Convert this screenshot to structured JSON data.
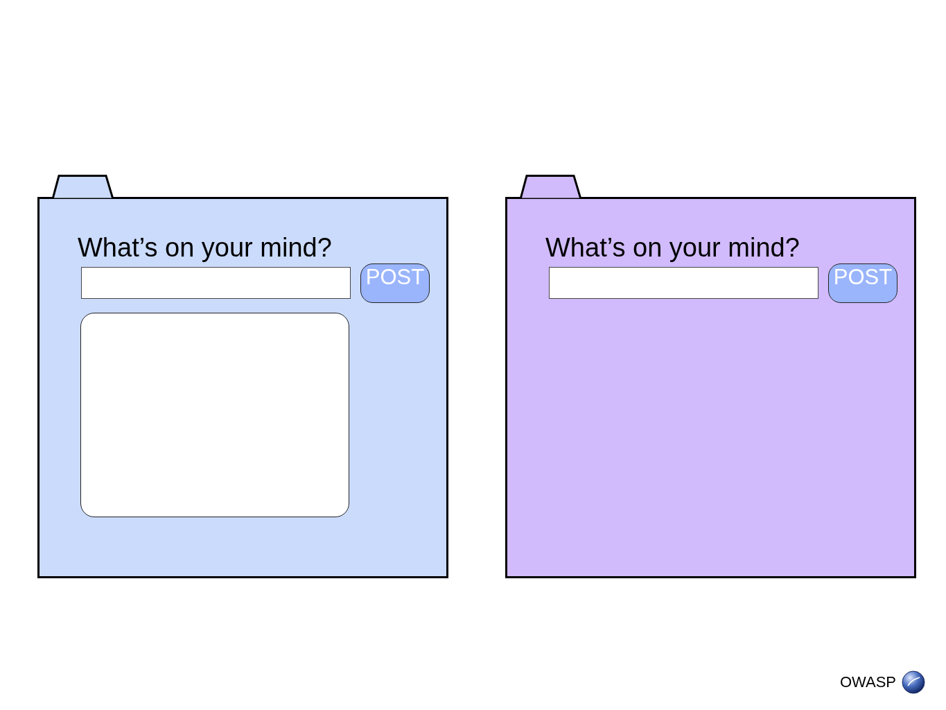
{
  "panels": [
    {
      "color": "#cbdbfc",
      "question": "What’s on your mind?",
      "post_button": "POST",
      "text_area": true
    },
    {
      "color": "#d1bbfc",
      "question": "What’s on your mind?",
      "post_button": "POST",
      "text_area": false
    }
  ],
  "footer": {
    "brand": "OWASP"
  }
}
